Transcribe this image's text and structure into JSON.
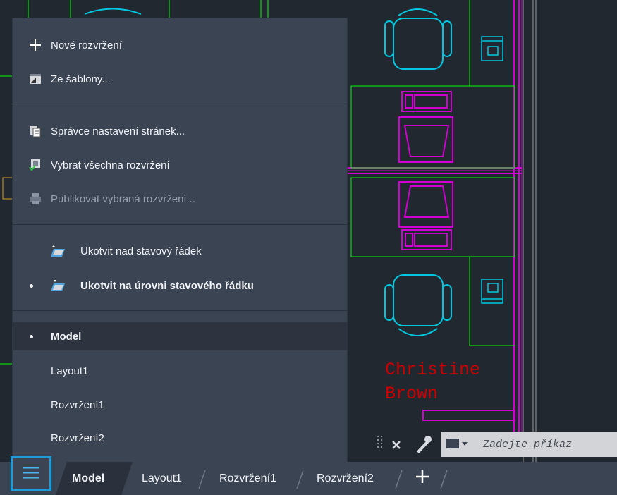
{
  "menu": {
    "items": [
      {
        "label": "Nové rozvržení",
        "icon": "plus-icon"
      },
      {
        "label": "Ze šablony...",
        "icon": "template-icon"
      },
      {
        "label": "Správce nastavení stránek...",
        "icon": "page-setup-icon"
      },
      {
        "label": "Vybrat všechna rozvržení",
        "icon": "select-layouts-icon"
      },
      {
        "label": "Publikovat vybraná rozvržení...",
        "icon": "publish-icon",
        "disabled": true
      },
      {
        "label": "Ukotvit nad stavový řádek",
        "icon": "dock-above-icon"
      },
      {
        "label": "Ukotvit na úrovni stavového řádku",
        "icon": "dock-inline-icon",
        "checked": true
      },
      {
        "label": "Model",
        "checked": true
      },
      {
        "label": "Layout1"
      },
      {
        "label": "Rozvržení1"
      },
      {
        "label": "Rozvržení2"
      }
    ]
  },
  "drawing": {
    "name_line1": "Christine",
    "name_line2": "Brown"
  },
  "command_line": {
    "placeholder": "Zadejte příkaz"
  },
  "tabs": {
    "items": [
      "Model",
      "Layout1",
      "Rozvržení1",
      "Rozvržení2"
    ],
    "active": "Model",
    "add_icon": "plus-icon"
  },
  "colors": {
    "background": "#212830",
    "menu_bg": "#3b4453",
    "accent_border": "#1e9bd7",
    "cad_green": "#00ff00",
    "cad_magenta": "#d000d0",
    "cad_cyan": "#00c8e0",
    "cad_red": "#cc0000"
  }
}
